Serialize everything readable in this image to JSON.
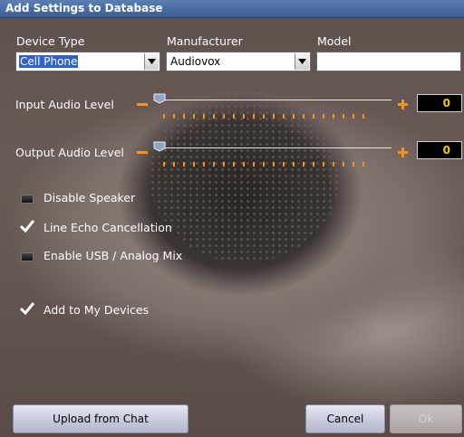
{
  "window": {
    "title": "Add Settings to Database"
  },
  "fields": {
    "device_type": {
      "label": "Device Type",
      "value": "Cell Phone"
    },
    "manufacturer": {
      "label": "Manufacturer",
      "value": "Audiovox"
    },
    "model": {
      "label": "Model",
      "value": ""
    }
  },
  "input_audio": {
    "label": "Input Audio Level",
    "value": "0",
    "level": 0
  },
  "output_audio": {
    "label": "Output Audio Level",
    "value": "0",
    "level": 0
  },
  "options": {
    "disable_speaker": {
      "label": "Disable Speaker",
      "checked": false
    },
    "line_echo": {
      "label": "Line Echo Cancellation",
      "checked": true
    },
    "usb_mix": {
      "label": "Enable USB / Analog Mix",
      "checked": false
    },
    "add_devices": {
      "label": "Add to My Devices",
      "checked": true
    }
  },
  "buttons": {
    "upload": "Upload from Chat",
    "cancel": "Cancel",
    "ok": "Ok"
  },
  "colors": {
    "accent": "#f7941d",
    "value_text": "#f5c800",
    "title_bar": "#4a6ea6"
  }
}
